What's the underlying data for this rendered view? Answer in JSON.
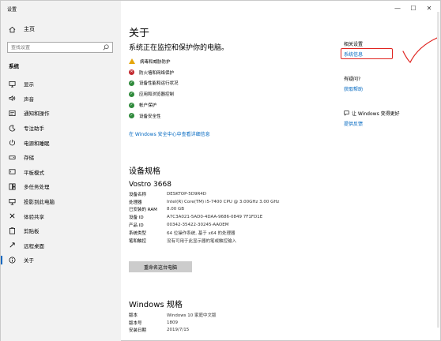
{
  "window": {
    "title": "设置",
    "controls": [
      "—",
      "☐",
      "✕"
    ]
  },
  "sidebar": {
    "home": "主页",
    "search_placeholder": "查找设置",
    "section": "系统",
    "items": [
      {
        "label": "显示",
        "icon": "monitor-icon"
      },
      {
        "label": "声音",
        "icon": "speaker-icon"
      },
      {
        "label": "通知和操作",
        "icon": "notification-icon"
      },
      {
        "label": "专注助手",
        "icon": "moon-icon"
      },
      {
        "label": "电源和睡眠",
        "icon": "power-icon"
      },
      {
        "label": "存储",
        "icon": "storage-icon"
      },
      {
        "label": "平板模式",
        "icon": "tablet-icon"
      },
      {
        "label": "多任务处理",
        "icon": "multitask-icon"
      },
      {
        "label": "投影到此电脑",
        "icon": "project-icon"
      },
      {
        "label": "体验共享",
        "icon": "share-icon"
      },
      {
        "label": "剪贴板",
        "icon": "clipboard-icon"
      },
      {
        "label": "远程桌面",
        "icon": "remote-icon"
      },
      {
        "label": "关于",
        "icon": "info-icon",
        "active": true
      }
    ]
  },
  "main": {
    "title": "关于",
    "protect_heading": "系统正在监控和保护你的电脑。",
    "status": [
      {
        "label": "病毒和威胁防护",
        "state": "warn"
      },
      {
        "label": "防火墙和网络保护",
        "state": "bad"
      },
      {
        "label": "设备性能和运行状况",
        "state": "ok"
      },
      {
        "label": "应用和浏览器控制",
        "state": "ok"
      },
      {
        "label": "帐户保护",
        "state": "ok"
      },
      {
        "label": "设备安全性",
        "state": "ok"
      }
    ],
    "security_link": "在 Windows 安全中心中查看详细信息",
    "specs_title": "设备规格",
    "device_name": "Vostro 3668",
    "specs": [
      {
        "k": "设备名称",
        "v": "DESKTOP-5D9R4D"
      },
      {
        "k": "处理器",
        "v": "Intel(R) Core(TM) i5-7400 CPU @ 3.00GHz   3.00 GHz"
      },
      {
        "k": "已安装的 RAM",
        "v": "8.00 GB"
      },
      {
        "k": "设备 ID",
        "v": "A7C3A021-5AD0-4DAA-9686-0849 7F1FD1E"
      },
      {
        "k": "产品 ID",
        "v": "00342-35422-30245-AAOEM"
      },
      {
        "k": "系统类型",
        "v": "64 位操作系统, 基于 x64 的处理器"
      },
      {
        "k": "笔和触控",
        "v": "没有可用于此显示器的笔或触控输入"
      }
    ],
    "rename_button": "重命名这台电脑",
    "windows_title": "Windows 规格",
    "windows_specs": [
      {
        "k": "版本",
        "v": "Windows 10 家庭中文版"
      },
      {
        "k": "版本号",
        "v": "1809"
      },
      {
        "k": "安装日期",
        "v": "2019/7/15"
      }
    ]
  },
  "related": {
    "title": "相关设置",
    "sysinfo_link": "系统信息",
    "question_title": "有疑问?",
    "help_link": "获取帮助",
    "improve_title": "让 Windows 变得更好",
    "feedback_link": "提供反馈"
  },
  "colors": {
    "accent": "#0067c0",
    "annotation_red": "#e0231f",
    "ok": "#2f8a3b",
    "bad": "#c2282e",
    "warn": "#e5a50a"
  }
}
